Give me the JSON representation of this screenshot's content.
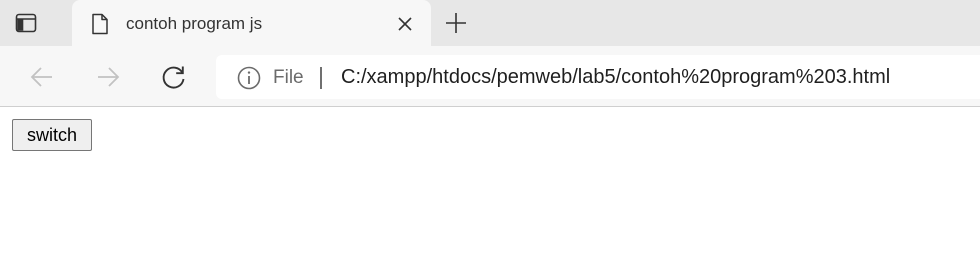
{
  "browser": {
    "tab": {
      "title": "contoh program js"
    },
    "address_bar": {
      "security_label": "File",
      "url": "C:/xampp/htdocs/pemweb/lab5/contoh%20program%203.html"
    }
  },
  "page": {
    "switch_button_label": "switch"
  },
  "colors": {
    "tabstrip_bg": "#e7e7e7",
    "toolbar_bg": "#f7f7f7",
    "icon_active": "#333333",
    "icon_disabled": "#c2c2c2"
  },
  "icons": [
    "tab-actions-icon",
    "page-icon",
    "close-icon",
    "plus-icon",
    "back-arrow-icon",
    "forward-arrow-icon",
    "refresh-icon",
    "info-icon"
  ]
}
